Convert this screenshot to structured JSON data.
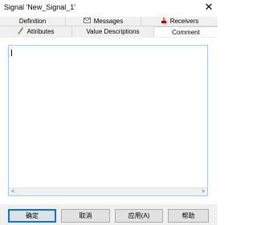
{
  "window": {
    "title": "Signal 'New_Signal_1'",
    "close_glyph": "✕"
  },
  "tabs": {
    "row1": [
      {
        "label": "Definition",
        "icon": ""
      },
      {
        "label": "Messages",
        "icon": "envelope-icon"
      },
      {
        "label": "Receivers",
        "icon": "receiver-icon"
      }
    ],
    "row2": [
      {
        "label": "Attributes",
        "icon": "attribute-icon"
      },
      {
        "label": "Value Descriptions",
        "icon": ""
      },
      {
        "label": "Comment",
        "icon": ""
      }
    ],
    "active": "Comment"
  },
  "comment": {
    "value": ""
  },
  "scrollbar": {
    "left_arrow": "<",
    "right_arrow": ">"
  },
  "buttons": {
    "ok": "确定",
    "cancel": "取消",
    "apply": "应用(A)",
    "help": "帮助"
  },
  "colors": {
    "accent": "#0078d7",
    "tab_bg": "#f0f0f0",
    "field_border": "#a9c8e8",
    "receiver_icon": "#c00000",
    "attribute_icon": "#3a8c2f"
  }
}
